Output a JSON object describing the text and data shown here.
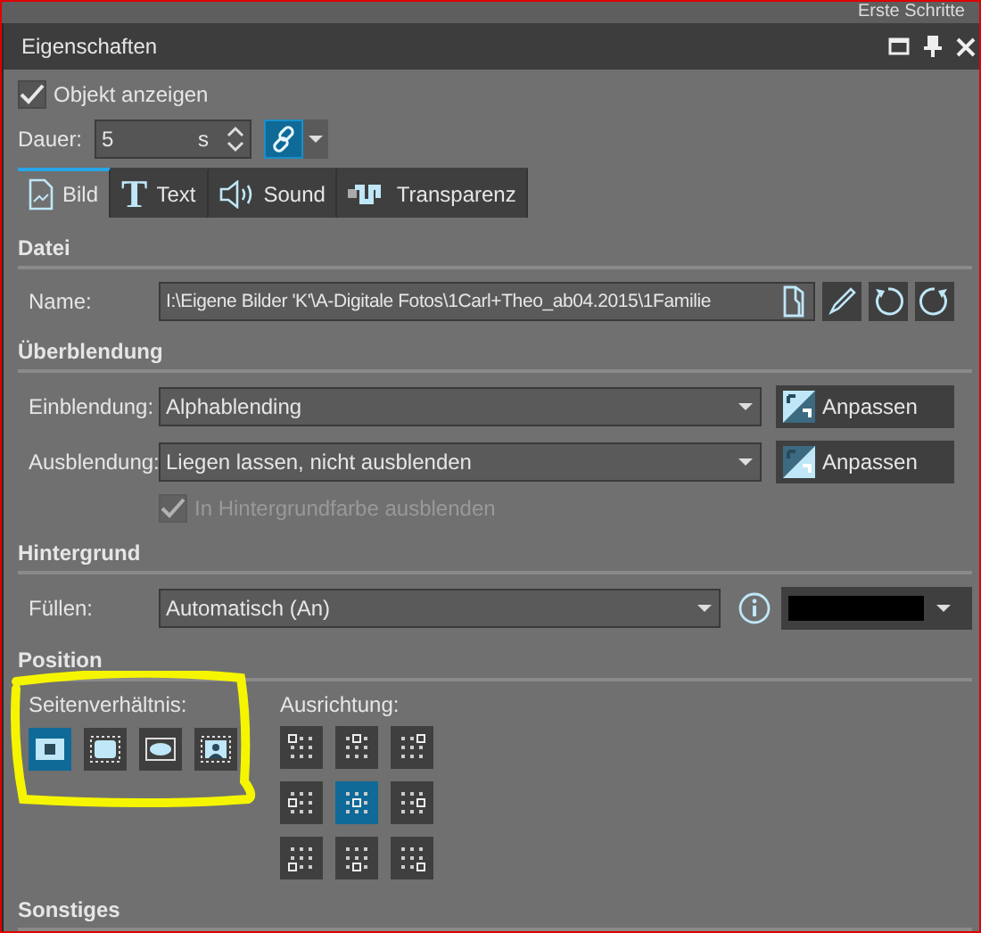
{
  "top_bar": {
    "title": "Erste Schritte"
  },
  "panel": {
    "title": "Eigenschaften"
  },
  "show_object": {
    "label": "Objekt anzeigen",
    "checked": true
  },
  "duration": {
    "label": "Dauer:",
    "value": "5",
    "unit": "s",
    "link_selected": true
  },
  "tabs": [
    {
      "label": "Bild",
      "kind": "image",
      "selected": true
    },
    {
      "label": "Text",
      "kind": "text",
      "icon_text": "T",
      "selected": false
    },
    {
      "label": "Sound",
      "kind": "sound",
      "selected": false
    },
    {
      "label": "Transparenz",
      "kind": "transparency",
      "selected": false
    }
  ],
  "file": {
    "heading": "Datei",
    "label": "Name:",
    "value": "I:\\Eigene Bilder 'K'\\A-Digitale Fotos\\1Carl+Theo_ab04.2015\\1Familie"
  },
  "transition": {
    "heading": "Überblendung",
    "rows": [
      {
        "label": "Einblendung:",
        "value": "Alphablending",
        "button": "Anpassen",
        "kind": "ab"
      },
      {
        "label": "Ausblendung:",
        "value": "Liegen lassen, nicht ausblenden",
        "button": "Anpassen",
        "kind": "ba"
      }
    ],
    "bg_fade": {
      "label": "In Hintergrundfarbe ausblenden",
      "checked": true,
      "disabled": true
    }
  },
  "background": {
    "heading": "Hintergrund",
    "label": "Füllen:",
    "value": "Automatisch (An)",
    "color": "#000000"
  },
  "position": {
    "heading": "Position",
    "aspect_label": "Seitenverhältnis:",
    "align_label": "Ausrichtung:",
    "aspect": [
      {
        "kind": "fit",
        "selected": true
      },
      {
        "kind": "fill",
        "selected": false
      },
      {
        "kind": "stretch",
        "selected": false
      },
      {
        "kind": "portrait",
        "selected": false
      }
    ],
    "alignment": [
      {
        "selected": false
      },
      {
        "selected": false
      },
      {
        "selected": false
      },
      {
        "selected": false
      },
      {
        "selected": true
      },
      {
        "selected": false
      },
      {
        "selected": false
      },
      {
        "selected": false
      },
      {
        "selected": false
      }
    ]
  },
  "other": {
    "heading": "Sonstiges"
  }
}
